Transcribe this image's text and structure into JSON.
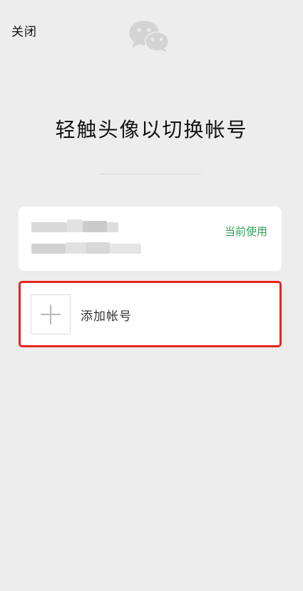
{
  "header": {
    "close_label": "关闭",
    "logo_icon": "wechat-logo-icon"
  },
  "title": "轻触头像以切换帐号",
  "current_account": {
    "status_label": "当前使用",
    "status_color": "#2fa35a"
  },
  "add_account": {
    "label": "添加帐号",
    "icon": "plus-icon",
    "highlight_color": "#e52420"
  },
  "colors": {
    "background": "#ededed",
    "card": "#ffffff"
  }
}
